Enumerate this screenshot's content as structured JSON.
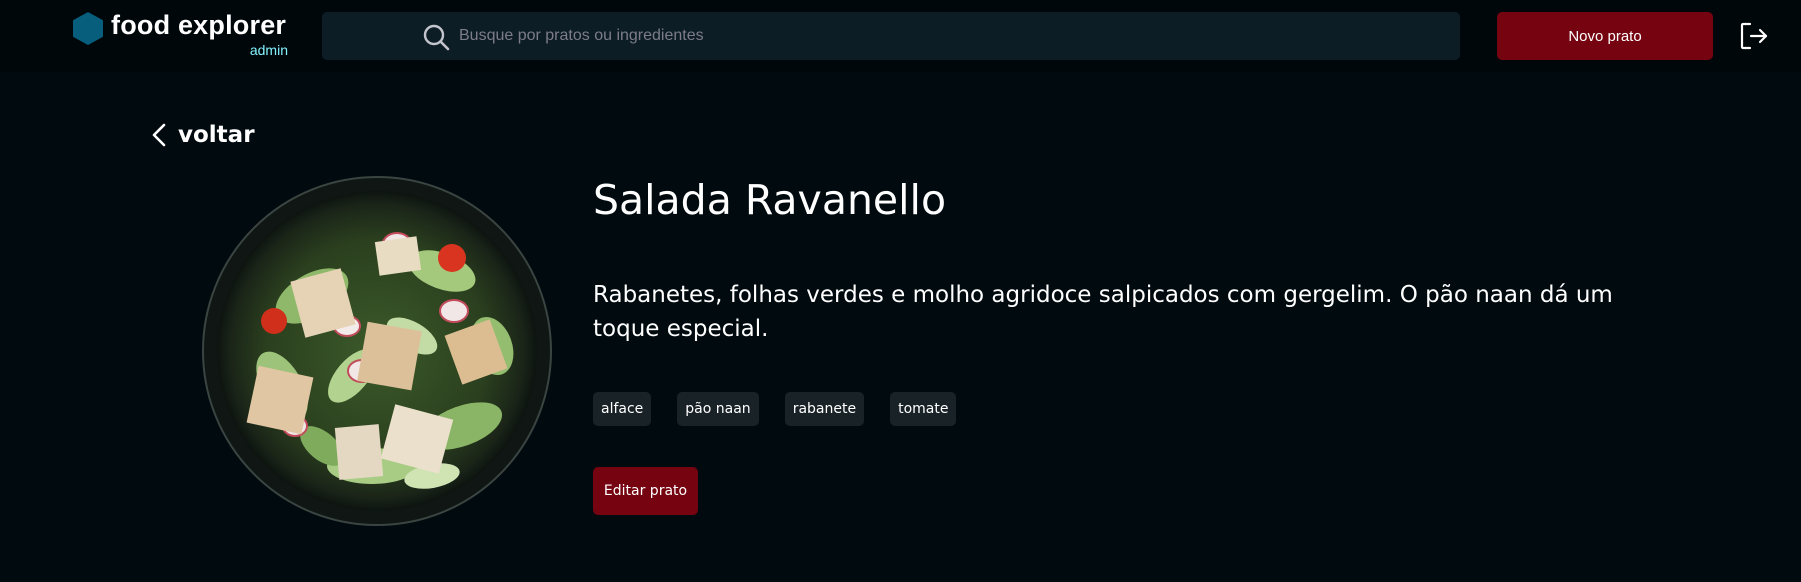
{
  "header": {
    "logo_text": "food explorer",
    "logo_sub": "admin",
    "search_placeholder": "Busque por pratos ou ingredientes",
    "new_button_label": "Novo prato",
    "accent_color": "#750310"
  },
  "icons": {
    "logo": "hexagon-icon",
    "search": "search-icon",
    "logout": "sign-out-icon",
    "back": "chevron-left-icon"
  },
  "main": {
    "back_label": "voltar",
    "dish": {
      "title": "Salada Ravanello",
      "description": "Rabanetes, folhas verdes e molho agridoce salpicados com gergelim. O pão naan dá um toque especial.",
      "tags": [
        "alface",
        "pão naan",
        "rabanete",
        "tomate"
      ],
      "edit_button_label": "Editar prato"
    }
  }
}
